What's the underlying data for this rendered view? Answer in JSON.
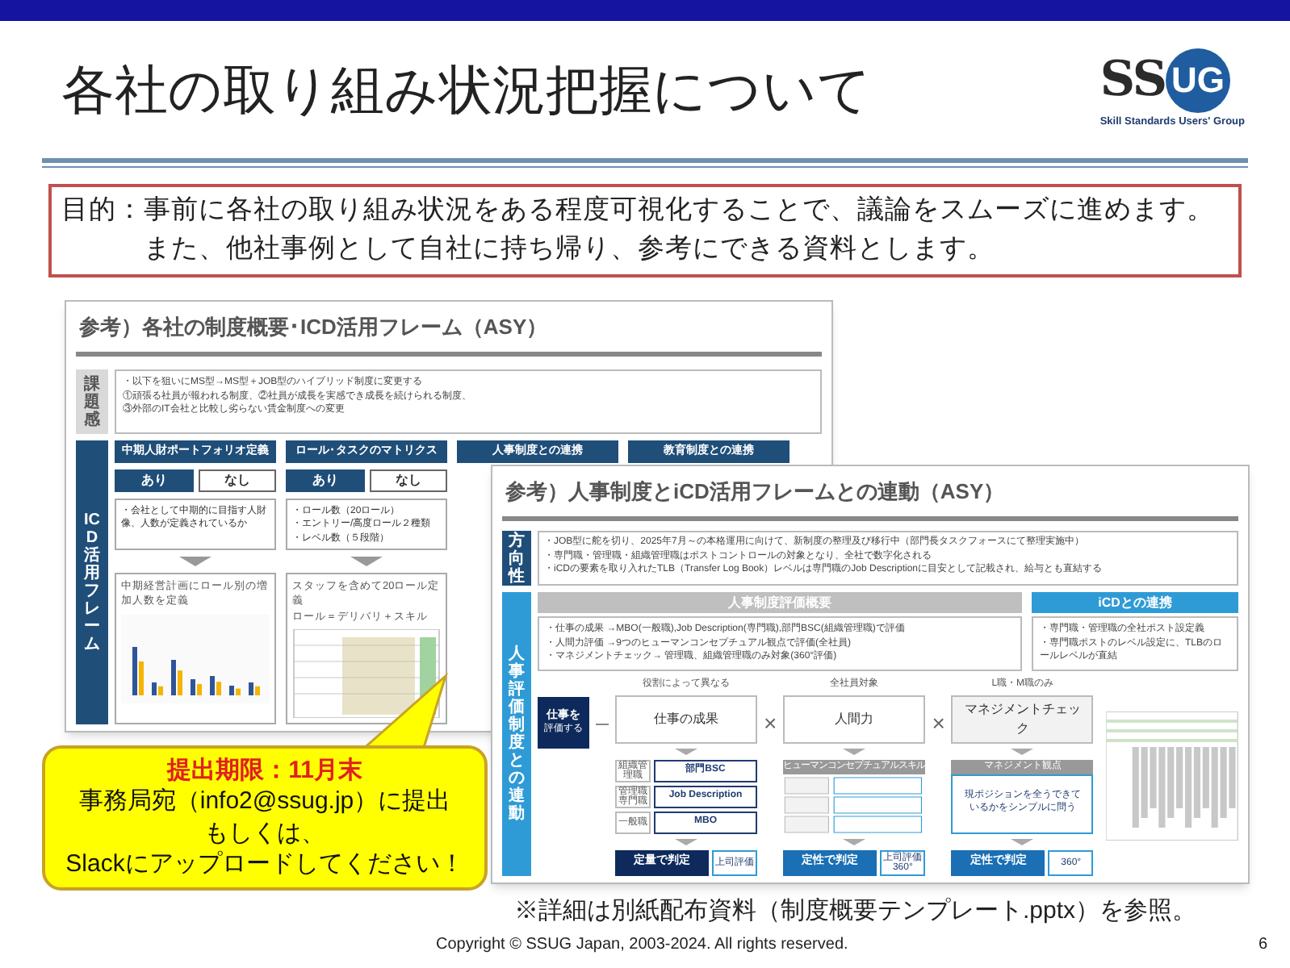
{
  "header": {
    "title": "各社の取り組み状況把握について",
    "logo": {
      "left": "SS",
      "circle": "UG",
      "tagline": "Skill Standards Users' Group"
    }
  },
  "purpose": {
    "label": "目的：",
    "text": "事前に各社の取り組み状況をある程度可視化することで、議論をスムーズに進めます。また、他社事例として自社に持ち帰り、参考にできる資料とします。"
  },
  "doc_overview": {
    "title": "参考）各社の制度概要･ICD活用フレーム（ASY）",
    "issue": {
      "label": "課題感",
      "lines": [
        "・以下を狙いにMS型→MS型＋JOB型のハイブリッド制度に変更する",
        "①頑張る社員が報われる制度、②社員が成長を実感でき成長を続けられる制度、",
        "③外部のIT会社と比較し劣らない賃金制度への変更"
      ]
    },
    "framework": {
      "label": "ICD活用フレーム",
      "columns": [
        {
          "header": "中期人財ポートフォリオ定義",
          "options": [
            {
              "label": "あり",
              "selected": true
            },
            {
              "label": "なし",
              "selected": false
            }
          ],
          "summary": [
            "・会社として中期的に目指す人財像、人数が定義されているか"
          ],
          "detail": [
            "中期経営計画にロール別の増加人数を定義"
          ],
          "kind": "chart"
        },
        {
          "header": "ロール･タスクのマトリクス",
          "options": [
            {
              "label": "あり",
              "selected": true
            },
            {
              "label": "なし",
              "selected": false
            }
          ],
          "summary": [
            "・ロール数（20ロール）",
            "・エントリー/高度ロール２種類",
            "・レベル数（５段階）"
          ],
          "detail": [
            "スタッフを含めて20ロール定義",
            "ロール＝デリバリ＋スキル"
          ],
          "kind": "table"
        },
        {
          "header": "人事制度との連携"
        },
        {
          "header": "教育制度との連携"
        }
      ]
    }
  },
  "doc_linkage": {
    "title": "参考）人事制度とiCD活用フレームとの連動（ASY）",
    "direction": {
      "label": "方向性",
      "lines": [
        "・JOB型に舵を切り、2025年7月～の本格運用に向けて、新制度の整理及び移行中（部門長タスクフォースにて整理実施中）",
        "・専門職・管理職・組織管理職はポストコントロールの対象となり、全社で数字化される",
        "・iCDの要素を取り入れたTLB（Transfer Log Book）レベルは専門職のJob Descriptionに目安として記載され、給与とも直結する"
      ]
    },
    "evaluation": {
      "label": "人事評価制度との連動",
      "overview": {
        "header": "人事制度評価概要",
        "lines": [
          "・仕事の成果 →MBO(一般職),Job Description(専門職),部門BSC(組織管理職)で評価",
          "・人間力評価 →9つのヒューマンコンセプチュアル観点で評価(全社員)",
          "・マネジメントチェック→ 管理職、組織管理職のみ対象(360°評価)"
        ]
      },
      "icd": {
        "header": "iCDとの連携",
        "lines": [
          "・専門職・管理職の全社ポスト設定義",
          "・専門職ポストのレベル設定に、TLBのロールレベルが直結"
        ]
      },
      "start": {
        "main": "仕事を",
        "sub": "評価する"
      },
      "operators": [
        "×",
        "×"
      ],
      "factors": [
        {
          "kind": "grades",
          "note": "役割によって異なる",
          "name": "仕事の成果",
          "items": [
            {
              "grade": "組織管理職",
              "tool": "部門BSC"
            },
            {
              "grade": "管理職専門職",
              "tool": "Job Description"
            },
            {
              "grade": "一般職",
              "tool": "MBO"
            }
          ],
          "judgement": "定量で判定",
          "evaluator": "上司評価"
        },
        {
          "kind": "skills",
          "note": "全社員対象",
          "name": "人間力",
          "heading": "ヒューマンコンセプチュアルスキル",
          "judgement": "定性で判定",
          "evaluator": "上司評価 360°"
        },
        {
          "kind": "check",
          "note": "L職・M職のみ",
          "name": "マネジメントチェック",
          "heading": "マネジメント観点",
          "text": "現ポジションを全うできているかをシンプルに問う",
          "judgement": "定性で判定",
          "evaluator": "360°"
        }
      ]
    }
  },
  "callout": {
    "deadline": "提出期限：11月末",
    "lines": [
      "事務局宛（info2@ssug.jp）に提出",
      "もしくは、",
      "Slackにアップロードしてください！"
    ]
  },
  "note": "※詳細は別紙配布資料（制度概要テンプレート.pptx）を参照。",
  "footer": {
    "copyright": "Copyright © SSUG Japan, 2003-2024. All rights reserved.",
    "page": "6"
  }
}
